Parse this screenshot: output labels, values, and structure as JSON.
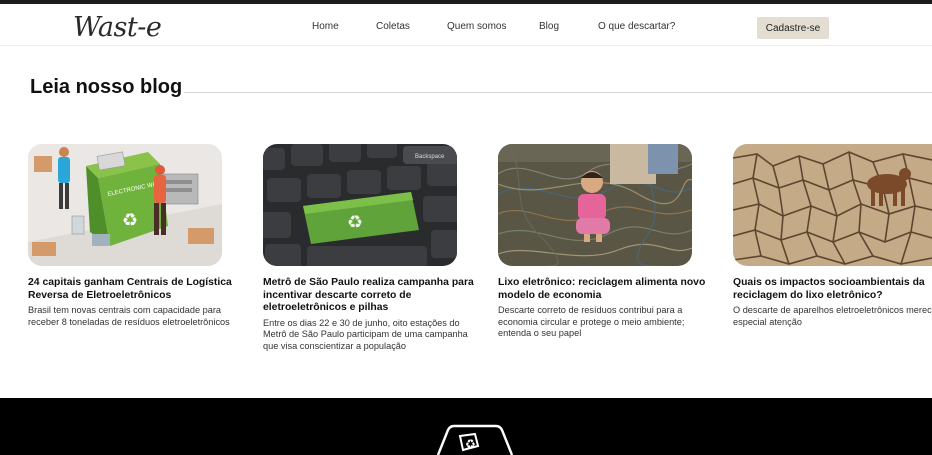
{
  "brand": {
    "logo_text": "Wast-e"
  },
  "nav": {
    "items": [
      "Home",
      "Coletas",
      "Quem somos",
      "Blog",
      "O que descartar?"
    ],
    "signup_label": "Cadastre-se"
  },
  "blog": {
    "section_title": "Leia nosso blog",
    "posts": [
      {
        "title": "24 capitais ganham Centrais de Logística Reversa de Eletroeletrônicos",
        "description": "Brasil tem novas centrais com capacidade para receber 8 toneladas de resíduos eletroeletrônicos",
        "image": "illustration-electronic-waste-bin",
        "image_label": "ELECTRONIC WASTE"
      },
      {
        "title": "Metrô de São Paulo realiza campanha para incentivar descarte correto de eletroeletrônicos e pilhas",
        "description": "Entre os dias 22 e 30 de junho, oito estações do Metrô de São Paulo participam de uma campanha que visa conscientizar a população",
        "image": "photo-keyboard-recycle-key",
        "image_label": "Backspace"
      },
      {
        "title": "Lixo eletrônico: reciclagem alimenta novo modelo de economia",
        "description": "Descarte correto de resíduos contribui para a economia circular e protege o meio ambiente; entenda o seu papel",
        "image": "photo-child-on-cable-pile",
        "image_label": ""
      },
      {
        "title": "Quais os impactos socioambientais da reciclagem do lixo eletrônico?",
        "description": "O descarte de aparelhos eletroeletrônicos merece especial atenção",
        "image": "photo-cracked-dry-soil",
        "image_label": ""
      }
    ]
  },
  "footer": {
    "logo_icon": "recycle-bin-icon"
  },
  "colors": {
    "signup_bg": "#e3ddd2",
    "footer_bg": "#000000",
    "keyboard_green": "#5fa33a"
  }
}
